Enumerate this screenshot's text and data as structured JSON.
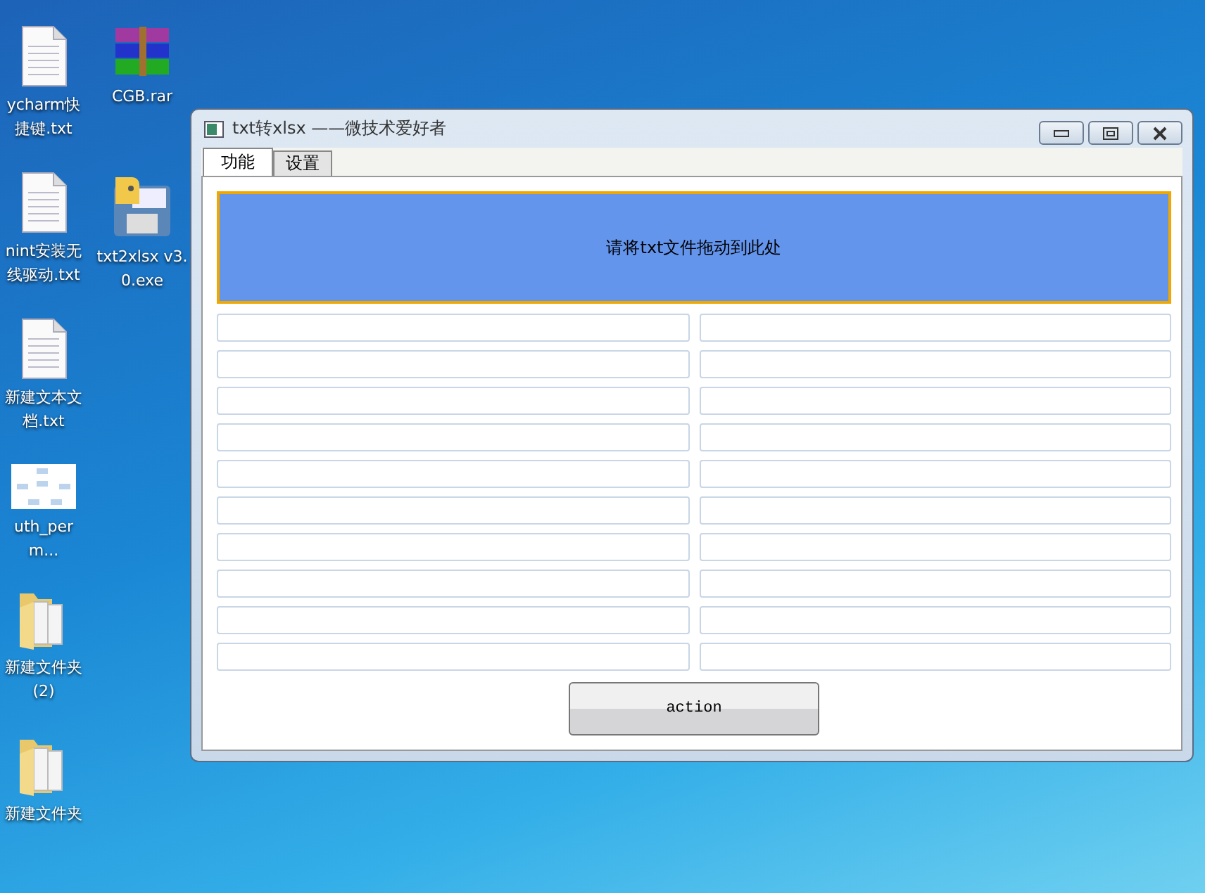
{
  "desktop_columns": [
    [
      {
        "kind": "text-file",
        "label": "ycharm快捷键.txt"
      },
      {
        "kind": "text-file",
        "label": "nint安装无线驱动.txt"
      },
      {
        "kind": "text-file",
        "label": "新建文本文档.txt"
      },
      {
        "kind": "image",
        "label": "uth_perm..."
      },
      {
        "kind": "folder",
        "label": "新建文件夹 (2)"
      },
      {
        "kind": "folder",
        "label": "新建文件夹"
      }
    ],
    [
      {
        "kind": "archive",
        "label": "CGB.rar"
      },
      {
        "kind": "program",
        "label": "txt2xlsx v3.0.exe"
      }
    ]
  ],
  "window": {
    "title": "txt转xlsx ——微技术爱好者"
  },
  "tabs": [
    {
      "label": "功能",
      "selected": true
    },
    {
      "label": "设置",
      "selected": false
    }
  ],
  "drop_zone": {
    "text": "请将txt文件拖动到此处"
  },
  "field_rows": [
    [
      {
        "kind": "text"
      },
      {
        "kind": "text"
      }
    ],
    [
      {
        "kind": "text"
      },
      {
        "kind": "text"
      }
    ],
    [
      {
        "kind": "text"
      },
      {
        "kind": "text"
      }
    ],
    [
      {
        "kind": "text"
      },
      {
        "kind": "text"
      }
    ],
    [
      {
        "kind": "text"
      },
      {
        "kind": "text"
      }
    ],
    [
      {
        "kind": "text"
      },
      {
        "kind": "text"
      }
    ],
    [
      {
        "kind": "text"
      },
      {
        "kind": "text"
      }
    ],
    [
      {
        "kind": "text"
      },
      {
        "kind": "text"
      }
    ],
    [
      {
        "kind": "text"
      },
      {
        "kind": "text"
      }
    ],
    [
      {
        "kind": "text"
      },
      {
        "kind": "text"
      }
    ]
  ],
  "action_button": {
    "label": "action"
  }
}
